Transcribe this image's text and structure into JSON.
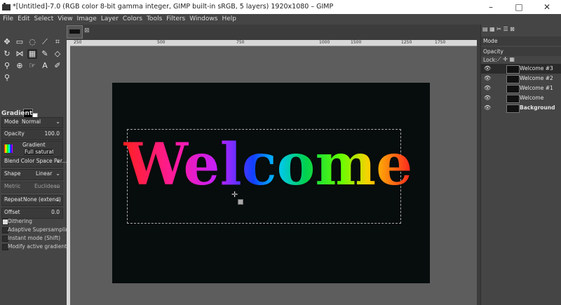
{
  "window": {
    "title": "*[Untitled]-7.0 (RGB color 8-bit gamma integer, GIMP built-in sRGB, 5 layers) 1920x1080 – GIMP",
    "minimize": "–",
    "maximize": "□",
    "close": "✕"
  },
  "menu": [
    "File",
    "Edit",
    "Select",
    "View",
    "Image",
    "Layer",
    "Colors",
    "Tools",
    "Filters",
    "Windows",
    "Help"
  ],
  "tool_options": {
    "title": "Gradient",
    "mode_label": "Mode",
    "mode_value": "Normal",
    "opacity_label": "Opacity",
    "opacity_value": "100.0",
    "gradient_label": "Gradient",
    "gradient_value": "Full saturation",
    "blend_space": "Blend Color Space Per...",
    "shape_label": "Shape",
    "shape_value": "Linear",
    "metric_label": "Metric",
    "metric_value": "Euclidean",
    "repeat_label": "Repeat",
    "repeat_value": "None (extend)",
    "offset_label": "Offset",
    "offset_value": "0.0",
    "dithering": "Dithering",
    "adaptive": "Adaptive Supersampling",
    "instant": "Instant mode (Shift)",
    "modify": "Modify active gradient"
  },
  "ruler_ticks": [
    "250",
    "500",
    "750",
    "1000",
    "1250",
    "1500",
    "1750"
  ],
  "canvas_text": "Welcome",
  "layers_panel": {
    "mode_label": "Mode",
    "opacity_label": "Opacity",
    "lock_label": "Lock:",
    "layers": [
      "Welcome #3",
      "Welcome #2",
      "Welcome #1",
      "Welcome",
      "Background"
    ]
  }
}
